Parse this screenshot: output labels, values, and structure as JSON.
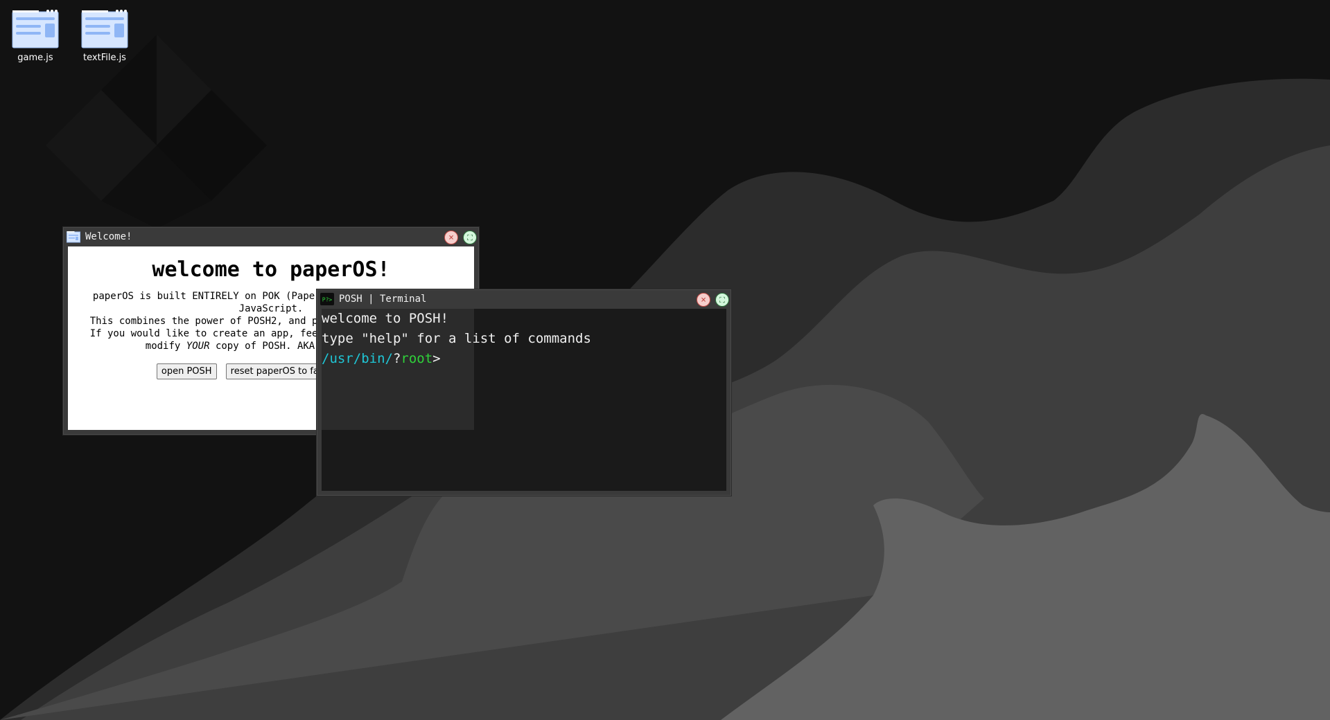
{
  "desktop": {
    "icons": [
      {
        "label": "game.js",
        "icon": "app-window-icon"
      },
      {
        "label": "textFile.js",
        "icon": "app-window-icon"
      }
    ]
  },
  "welcome_window": {
    "title": "Welcome!",
    "heading": "welcome to paperOS!",
    "lines": [
      "paperOS is built ENTIRELY on POK (PaperOS Kernel), written in JavaScript.",
      "This combines the power of POSH2, and puts it all on one page.",
      "If you would like to create an app, feel free to check out and",
      "modify",
      "YOUR",
      "copy of POSH. AKA the terminal!"
    ],
    "buttons": {
      "open": "open POSH",
      "reset": "reset paperOS to factory settings"
    },
    "close_symbol": "×",
    "max_symbol": "⛶"
  },
  "terminal_window": {
    "title": "POSH | Terminal",
    "icon_text": "P?>",
    "lines": [
      "welcome to POSH!",
      "type \"help\" for a list of commands"
    ],
    "prompt": {
      "path": "/usr/bin/",
      "marker": "?",
      "user": "root",
      "symbol": ">"
    },
    "close_symbol": "×",
    "max_symbol": "⛶"
  },
  "colors": {
    "background": "#121212",
    "window_frame": "#3a3a3a",
    "terminal_bg": "#1a1a1a",
    "prompt_path": "#1fc6d6",
    "prompt_user": "#2fd23a",
    "close_button": "#f6cfcd",
    "maximize_button": "#d4f7dc"
  }
}
